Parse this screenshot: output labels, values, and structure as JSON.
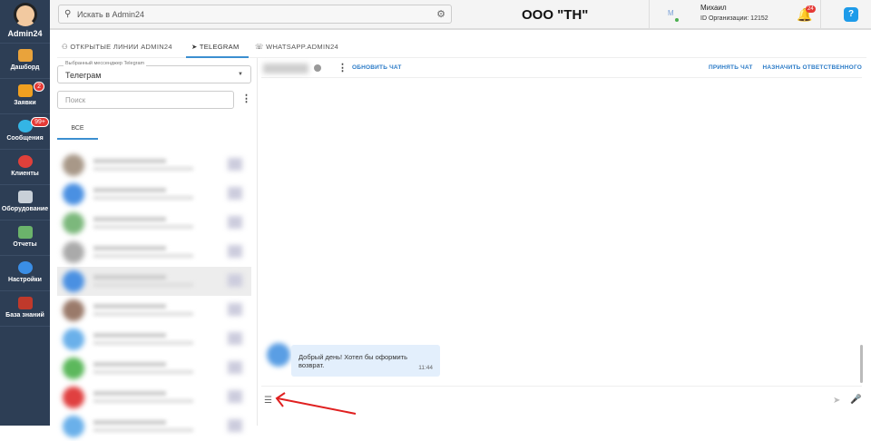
{
  "sidebar": {
    "brand": "Admin24",
    "items": [
      {
        "label": "Дашборд",
        "icon": "dashboard-icon",
        "color": "#e9a33b"
      },
      {
        "label": "Заявки",
        "icon": "megaphone-icon",
        "color": "#f0a020",
        "badge": "2"
      },
      {
        "label": "Сообщения",
        "icon": "chat-bubbles-icon",
        "color": "#34b5e5",
        "badge": "99+"
      },
      {
        "label": "Клиенты",
        "icon": "clients-icon",
        "color": "#e0403a"
      },
      {
        "label": "Оборудование",
        "icon": "equipment-icon",
        "color": "#c8d0d8"
      },
      {
        "label": "Отчеты",
        "icon": "reports-icon",
        "color": "#6bb36b"
      },
      {
        "label": "Настройки",
        "icon": "settings-icon",
        "color": "#3a8ee6"
      },
      {
        "label": "База знаний",
        "icon": "knowledge-base-icon",
        "color": "#c0392b"
      }
    ]
  },
  "header": {
    "search_placeholder": "Искать в Admin24",
    "org": "ООО \"ТН\"",
    "user_initial": "М",
    "user_name": "Михаил",
    "org_id": "ID Организации: 12152",
    "notifications": "24",
    "help": "?"
  },
  "tabs": [
    "ОТКРЫТЫЕ ЛИНИИ ADMIN24",
    "TELEGRAM",
    "WHATSAPP.ADMIN24"
  ],
  "left": {
    "select_label": "Выбранный мессенджер Telegram",
    "select_value": "Телеграм",
    "search_placeholder": "Поиск",
    "filter_tab": "ВСЕ"
  },
  "chat": {
    "refresh": "ОБНОВИТЬ ЧАТ",
    "accept": "ПРИНЯТЬ ЧАТ",
    "assign": "НАЗНАЧИТЬ ОТВЕТСТВЕННОГО",
    "messages": [
      {
        "text": "Добрый день! Хотел бы оформить возврат.",
        "time": "11:44"
      }
    ]
  },
  "colors": {
    "sidebar": "#2d3e55",
    "accent": "#2b7bc7",
    "bubble": "#e3effc"
  }
}
